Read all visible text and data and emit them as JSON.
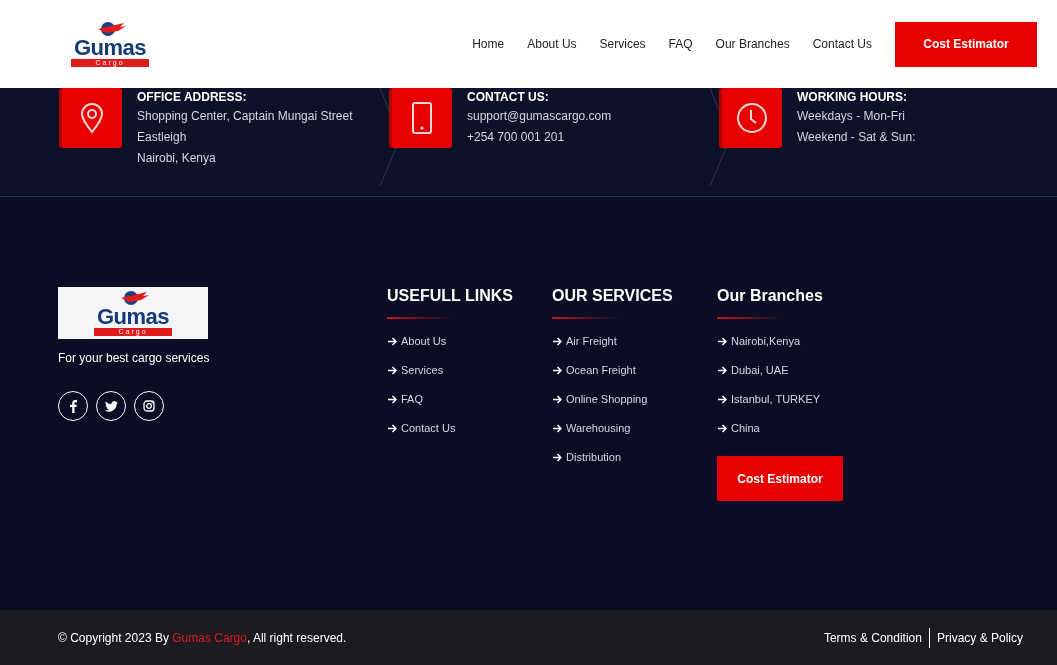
{
  "header": {
    "logo": {
      "name": "Gumas",
      "tagline": "Cargo"
    },
    "nav": [
      {
        "label": "Home"
      },
      {
        "label": "About Us"
      },
      {
        "label": "Services"
      },
      {
        "label": "FAQ"
      },
      {
        "label": "Our Branches"
      },
      {
        "label": "Contact Us"
      }
    ],
    "cta": "Cost Estimator"
  },
  "info": [
    {
      "kind": "location",
      "title": "OFFICE ADDRESS:",
      "lines": [
        "Shopping Center, Captain Mungai Street",
        "Eastleigh",
        "Nairobi, Kenya"
      ]
    },
    {
      "kind": "phone",
      "title": "CONTACT US:",
      "lines": [
        "support@gumascargo.com",
        "+254 700 001 201"
      ]
    },
    {
      "kind": "clock",
      "title": "WORKING HOURS:",
      "lines": [
        "Weekdays - Mon-Fri",
        "Weekend - Sat & Sun:"
      ]
    }
  ],
  "footer": {
    "logo": {
      "name": "Gumas",
      "tagline": "Cargo"
    },
    "tagline": "For your best cargo services",
    "social": [
      {
        "kind": "facebook"
      },
      {
        "kind": "twitter"
      },
      {
        "kind": "instagram"
      }
    ],
    "columns": [
      {
        "title": "USEFULL LINKS",
        "links": [
          "About Us",
          "Services",
          "FAQ",
          "Contact Us"
        ]
      },
      {
        "title": "OUR SERVICES",
        "links": [
          "Air Freight",
          "Ocean Freight",
          "Online Shopping",
          "Warehousing",
          "Distribution"
        ]
      },
      {
        "title": "Our Branches",
        "links": [
          "Nairobi,Kenya",
          "Dubai, UAE",
          "Istanbul, TURKEY",
          "China"
        ],
        "button": "Cost Estimator"
      }
    ]
  },
  "bottom_bar": {
    "copyright_prefix": "© Copyright 2023 By ",
    "copyright_link": "Gumas Cargo",
    "copyright_suffix": ", All right reserved.",
    "links": [
      "Terms & Condition",
      "Privacy & Policy"
    ]
  }
}
